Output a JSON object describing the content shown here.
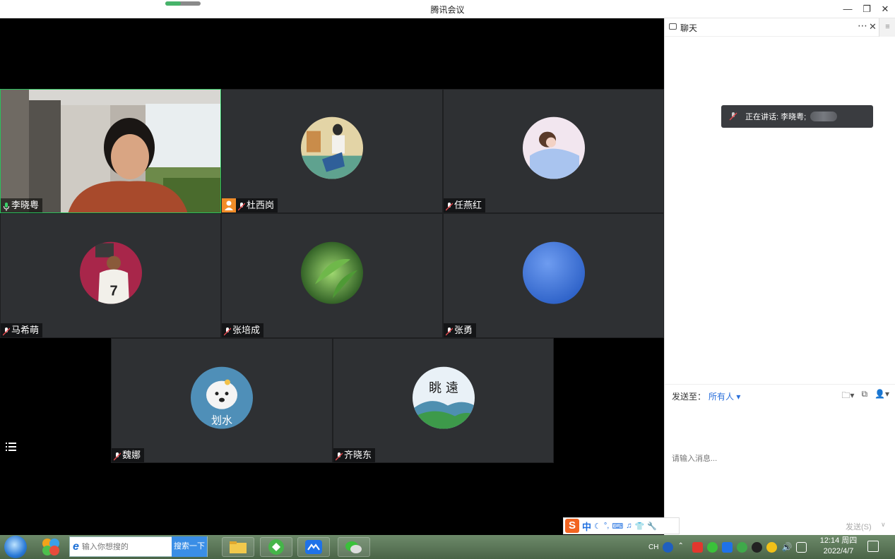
{
  "window": {
    "title": "腾讯会议"
  },
  "participants": [
    {
      "name": "李晓粤",
      "speaking": true
    },
    {
      "name": "杜西岗"
    },
    {
      "name": "任燕红"
    },
    {
      "name": "马希萌"
    },
    {
      "name": "张培成"
    },
    {
      "name": "张勇"
    },
    {
      "name": "魏娜"
    },
    {
      "name": "齐晓东"
    }
  ],
  "avatar_texts": {
    "weina": "划水",
    "qixiaodong": "眺 遠"
  },
  "chat": {
    "title": "聊天",
    "toast": "正在讲话: 李晓粤;",
    "send_to_label": "发送至：",
    "send_to_value": "所有人 ▾",
    "placeholder": "请输入消息...",
    "send_label": "发送(S)"
  },
  "ime": {
    "lang": "中"
  },
  "taskbar": {
    "search_placeholder": "输入你想搜的",
    "search_button": "搜索一下",
    "lang": "CH",
    "time": "12:14 周四",
    "date": "2022/4/7"
  },
  "colors": {
    "speaking_border": "#29c15c",
    "tile_bg": "#2e3033",
    "accent": "#2a6fdb"
  }
}
